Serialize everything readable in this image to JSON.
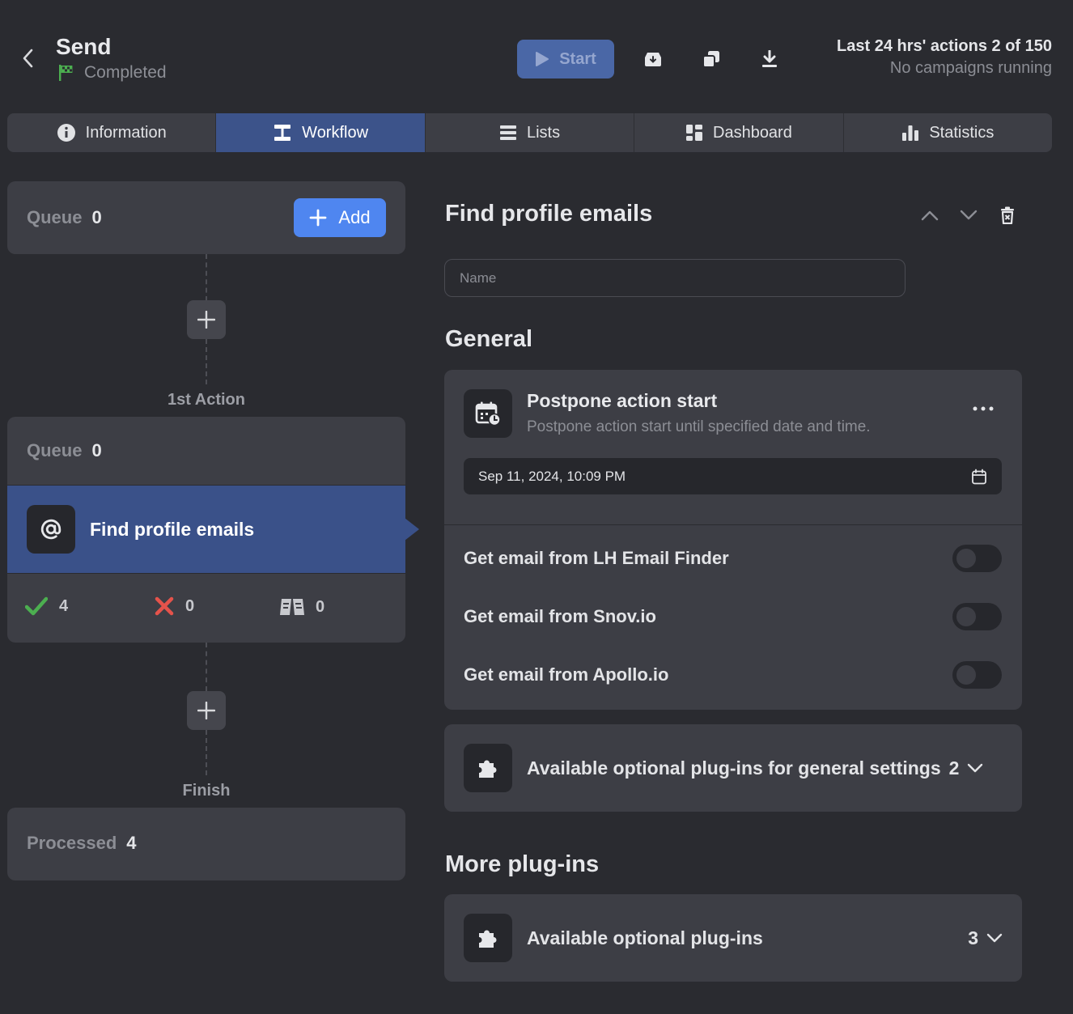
{
  "header": {
    "title": "Send",
    "status": "Completed",
    "start_label": "Start",
    "limits_line1": "Last 24 hrs' actions 2 of 150",
    "limits_line2": "No campaigns running"
  },
  "tabs": [
    {
      "label": "Information",
      "icon": "info-icon",
      "active": false
    },
    {
      "label": "Workflow",
      "icon": "workflow-icon",
      "active": true
    },
    {
      "label": "Lists",
      "icon": "list-icon",
      "active": false
    },
    {
      "label": "Dashboard",
      "icon": "dashboard-icon",
      "active": false
    },
    {
      "label": "Statistics",
      "icon": "bar-chart-icon",
      "active": false
    }
  ],
  "workflow": {
    "top_queue": {
      "label": "Queue",
      "value": "0",
      "add_label": "Add"
    },
    "step1_label": "1st Action",
    "action_queue": {
      "label": "Queue",
      "value": "0"
    },
    "action": {
      "name": "Find profile emails",
      "icon": "at-sign-icon"
    },
    "stats": {
      "success": "4",
      "failed": "0",
      "skipped": "0"
    },
    "finish_label": "Finish",
    "processed": {
      "label": "Processed",
      "value": "4"
    }
  },
  "panel": {
    "title": "Find profile emails",
    "name_placeholder": "Name",
    "general_heading": "General",
    "postpone": {
      "title": "Postpone action start",
      "description": "Postpone action start until specified date and time.",
      "date": "Sep 11, 2024, 10:09 PM"
    },
    "toggles": [
      {
        "label": "Get email from LH Email Finder",
        "on": false
      },
      {
        "label": "Get email from Snov.io",
        "on": false
      },
      {
        "label": "Get email from Apollo.io",
        "on": false
      }
    ],
    "general_plugins": {
      "label": "Available optional plug-ins for general settings",
      "count": "2"
    },
    "more_heading": "More plug-ins",
    "more_plugins": {
      "label": "Available optional plug-ins",
      "count": "3"
    }
  },
  "colors": {
    "background": "#2a2b30",
    "card": "#3d3e45",
    "accent": "#3a5189",
    "add_button": "#4f86f0",
    "success": "#4caf50",
    "danger": "#e5534b",
    "flag": "#4caf50"
  }
}
